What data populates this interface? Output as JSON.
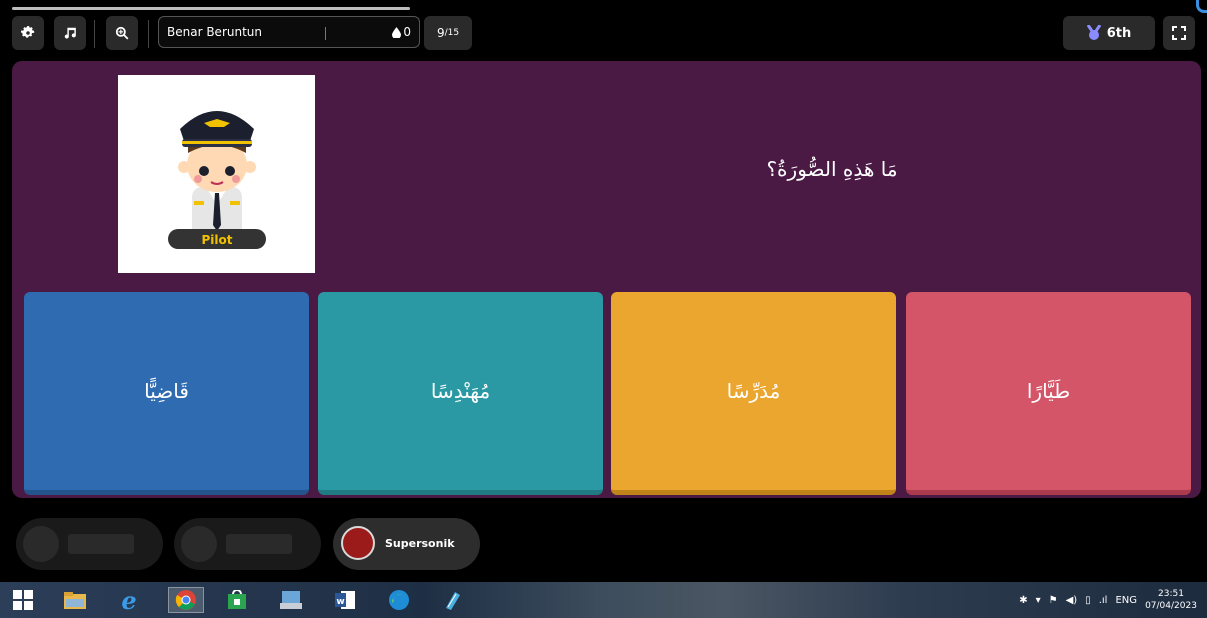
{
  "game": {
    "progress_fraction": 1.0,
    "player_name": "Benar Beruntun",
    "score": "0",
    "question_counter": {
      "current": "9",
      "total": "/15"
    },
    "rank": "6th"
  },
  "question": {
    "text": "مَا هَذِهِ الصُّورَةُ؟",
    "image_label": "Pilot"
  },
  "options": [
    {
      "text": "قَاضِيًّا",
      "color": "#2e6bb0"
    },
    {
      "text": "مُهَنْدِسًا",
      "color": "#2b99a4"
    },
    {
      "text": "مُدَرِّسًا",
      "color": "#eba62f"
    },
    {
      "text": "طَيَّارًا",
      "color": "#d45468"
    }
  ],
  "powerups": {
    "supersonic_label": "Supersonik"
  },
  "taskbar": {
    "language": "ENG",
    "time": "23:51",
    "date": "07/04/2023"
  },
  "icons": [
    "gear-icon",
    "music-icon",
    "zoom-in-icon",
    "drop-icon",
    "medal-icon",
    "fullscreen-icon",
    "windows-start-icon",
    "file-explorer-icon",
    "internet-explorer-icon",
    "chrome-icon",
    "store-icon",
    "keyboard-icon",
    "word-icon",
    "edge-icon",
    "notepad-icon"
  ]
}
